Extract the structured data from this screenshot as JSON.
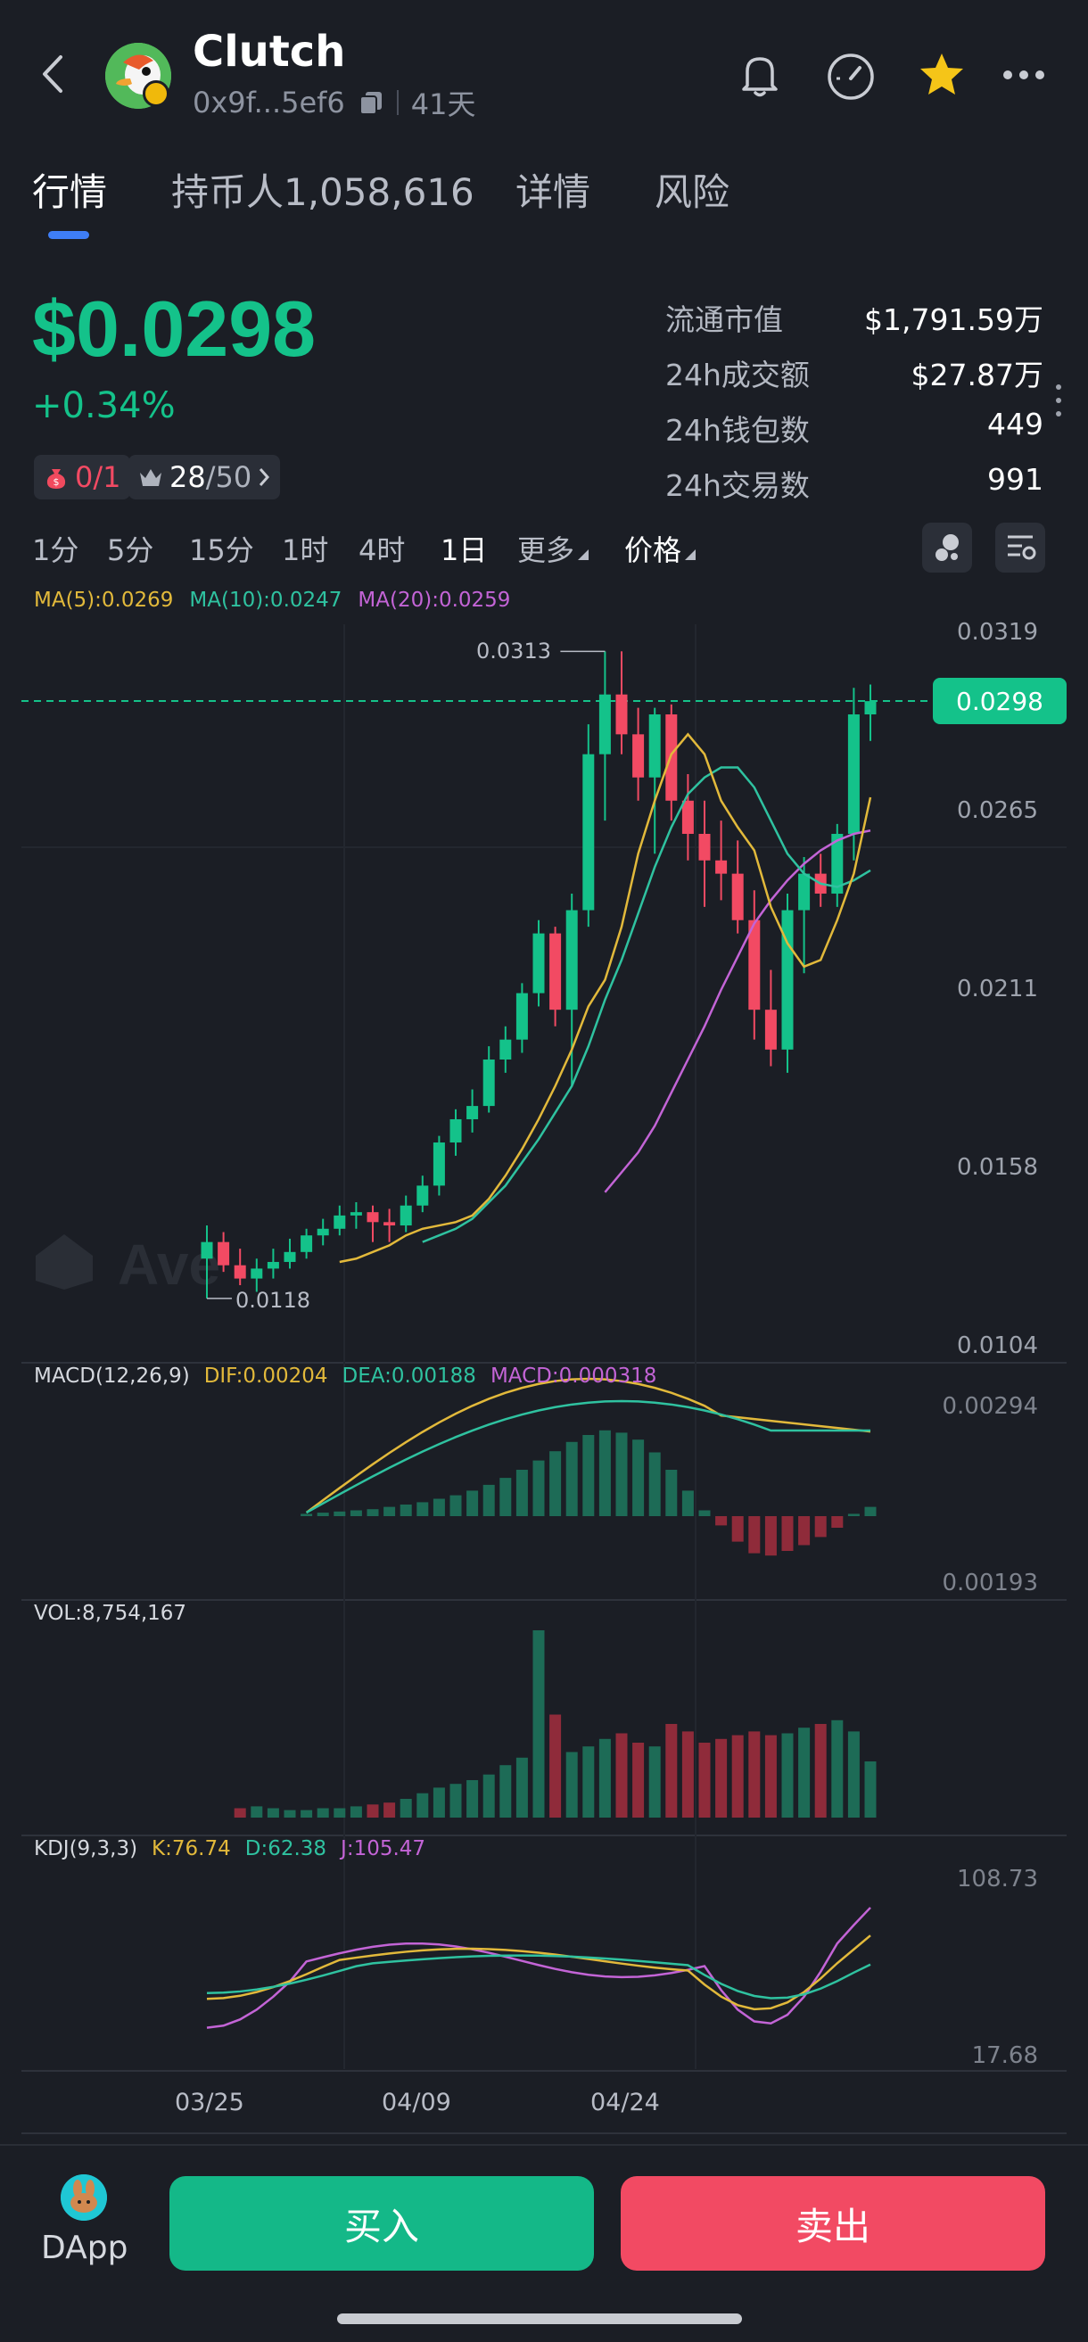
{
  "header": {
    "title": "Clutch",
    "address": "0x9f...5ef6",
    "age": "41天"
  },
  "tabs": [
    {
      "label": "行情"
    },
    {
      "label": "持币人1,058,616"
    },
    {
      "label": "详情"
    },
    {
      "label": "风险"
    }
  ],
  "price": {
    "value": "$0.0298",
    "change": "+0.34%",
    "badge1": "0/1",
    "badge2_value": "28",
    "badge2_total": "/50"
  },
  "stats": [
    {
      "label": "流通市值",
      "value": "$1,791.59万"
    },
    {
      "label": "24h成交额",
      "value": "$27.87万"
    },
    {
      "label": "24h钱包数",
      "value": "449"
    },
    {
      "label": "24h交易数",
      "value": "991"
    }
  ],
  "timeframes": [
    "1分",
    "5分",
    "15分",
    "1时",
    "4时",
    "1日",
    "更多",
    "价格"
  ],
  "chart": {
    "ma_legend": [
      "MA(5):0.0269",
      "MA(10):0.0247",
      "MA(20):0.0259"
    ],
    "price_axis": [
      "0.0319",
      "0.0265",
      "0.0211",
      "0.0158",
      "0.0104"
    ],
    "current_tag": "0.0298",
    "high_label": "0.0313",
    "low_label": "0.0118",
    "watermark": "Ave",
    "macd_legend": [
      "MACD(12,26,9)",
      "DIF:0.00204",
      "DEA:0.00188",
      "MACD:0.000318"
    ],
    "macd_axis": [
      "0.00294",
      "0.00193"
    ],
    "vol_legend": "VOL:8,754,167",
    "kdj_legend": [
      "KDJ(9,3,3)",
      "K:76.74",
      "D:62.38",
      "J:105.47"
    ],
    "kdj_axis": [
      "108.73",
      "17.68"
    ],
    "x_labels": [
      "03/25",
      "04/09",
      "04/24"
    ]
  },
  "colors": {
    "up": "#14c28a",
    "down": "#f24a63",
    "ma5": "#e2b93b",
    "ma10": "#2fc2a0",
    "ma20": "#c364d6"
  },
  "chart_data": {
    "type": "candlestick",
    "x_labels": [
      "03/25",
      "04/09",
      "04/24"
    ],
    "ylim": [
      0.0104,
      0.0319
    ],
    "candles_ohlc": [
      [
        0.013,
        0.014,
        0.0118,
        0.0135
      ],
      [
        0.0135,
        0.0138,
        0.0126,
        0.0128
      ],
      [
        0.0128,
        0.0133,
        0.0122,
        0.0124
      ],
      [
        0.0124,
        0.013,
        0.012,
        0.0127
      ],
      [
        0.0127,
        0.0133,
        0.0124,
        0.0129
      ],
      [
        0.0129,
        0.0136,
        0.0127,
        0.0132
      ],
      [
        0.0132,
        0.0139,
        0.013,
        0.0137
      ],
      [
        0.0137,
        0.0142,
        0.0134,
        0.0139
      ],
      [
        0.0139,
        0.0146,
        0.0137,
        0.0143
      ],
      [
        0.0143,
        0.0147,
        0.0139,
        0.0144
      ],
      [
        0.0144,
        0.0146,
        0.0135,
        0.0141
      ],
      [
        0.0141,
        0.0145,
        0.0135,
        0.014
      ],
      [
        0.014,
        0.0149,
        0.0138,
        0.0146
      ],
      [
        0.0146,
        0.0155,
        0.0144,
        0.0152
      ],
      [
        0.0152,
        0.0167,
        0.0149,
        0.0165
      ],
      [
        0.0165,
        0.0175,
        0.0161,
        0.0172
      ],
      [
        0.0172,
        0.0181,
        0.0168,
        0.0176
      ],
      [
        0.0176,
        0.0194,
        0.0174,
        0.019
      ],
      [
        0.019,
        0.02,
        0.0186,
        0.0196
      ],
      [
        0.0196,
        0.0213,
        0.0192,
        0.021
      ],
      [
        0.021,
        0.0232,
        0.0206,
        0.0228
      ],
      [
        0.0228,
        0.023,
        0.02,
        0.0205
      ],
      [
        0.0205,
        0.024,
        0.0182,
        0.0235
      ],
      [
        0.0235,
        0.0291,
        0.023,
        0.0282
      ],
      [
        0.0282,
        0.0313,
        0.0262,
        0.03
      ],
      [
        0.03,
        0.0313,
        0.0282,
        0.0288
      ],
      [
        0.0288,
        0.0296,
        0.0268,
        0.0275
      ],
      [
        0.0275,
        0.0296,
        0.0252,
        0.0294
      ],
      [
        0.0294,
        0.0297,
        0.0262,
        0.0268
      ],
      [
        0.0268,
        0.0276,
        0.025,
        0.0258
      ],
      [
        0.0258,
        0.0268,
        0.0236,
        0.025
      ],
      [
        0.025,
        0.0262,
        0.0238,
        0.0246
      ],
      [
        0.0246,
        0.0256,
        0.0228,
        0.0232
      ],
      [
        0.0232,
        0.0241,
        0.0196,
        0.0205
      ],
      [
        0.0205,
        0.0217,
        0.0188,
        0.0193
      ],
      [
        0.0193,
        0.024,
        0.0186,
        0.0235
      ],
      [
        0.0235,
        0.0251,
        0.0216,
        0.0246
      ],
      [
        0.0246,
        0.0252,
        0.0236,
        0.024
      ],
      [
        0.024,
        0.0261,
        0.0236,
        0.0258
      ],
      [
        0.0258,
        0.0302,
        0.025,
        0.0294
      ],
      [
        0.0294,
        0.0303,
        0.0286,
        0.0298
      ]
    ],
    "ma5": [
      0.0129,
      0.013,
      0.0132,
      0.0134,
      0.0137,
      0.0139,
      0.014,
      0.0141,
      0.0143,
      0.0148,
      0.0155,
      0.0163,
      0.0172,
      0.0182,
      0.0193,
      0.0206,
      0.0214,
      0.023,
      0.0252,
      0.0268,
      0.0282,
      0.0288,
      0.0282,
      0.0268,
      0.026,
      0.0253,
      0.0236,
      0.0225,
      0.0218,
      0.022,
      0.0232,
      0.0246,
      0.0269
    ],
    "ma10": [
      0.0135,
      0.0137,
      0.0139,
      0.0142,
      0.0147,
      0.0152,
      0.0159,
      0.0166,
      0.0174,
      0.0182,
      0.0194,
      0.0208,
      0.022,
      0.0234,
      0.0248,
      0.026,
      0.027,
      0.0275,
      0.0278,
      0.0278,
      0.0272,
      0.0262,
      0.0252,
      0.0246,
      0.0243,
      0.0242,
      0.0244,
      0.0247
    ],
    "ma20": [
      0.015,
      0.0156,
      0.0162,
      0.017,
      0.018,
      0.019,
      0.02,
      0.0211,
      0.0221,
      0.0231,
      0.0238,
      0.0244,
      0.0249,
      0.0253,
      0.0256,
      0.0258,
      0.0259
    ],
    "macd_hist": [
      2e-05,
      3e-05,
      4e-05,
      5e-05,
      6e-05,
      8e-05,
      0.0001,
      0.00012,
      0.00015,
      0.00018,
      0.00022,
      0.00027,
      0.00033,
      0.0004,
      0.00048,
      0.00056,
      0.00064,
      0.0007,
      0.00074,
      0.00072,
      0.00066,
      0.00055,
      0.0004,
      0.00022,
      5e-05,
      -8e-05,
      -0.00022,
      -0.00032,
      -0.00034,
      -0.0003,
      -0.00025,
      -0.00018,
      -0.0001,
      2e-05,
      8e-05
    ],
    "volume": [
      0.05,
      0.06,
      0.05,
      0.04,
      0.04,
      0.05,
      0.05,
      0.06,
      0.07,
      0.08,
      0.1,
      0.13,
      0.16,
      0.18,
      0.2,
      0.23,
      0.28,
      0.32,
      1.0,
      0.55,
      0.35,
      0.38,
      0.42,
      0.45,
      0.4,
      0.38,
      0.5,
      0.46,
      0.4,
      0.42,
      0.44,
      0.46,
      0.44,
      0.45,
      0.48,
      0.5,
      0.52,
      0.46,
      0.3
    ],
    "kdj": {
      "K_last": 76.74,
      "D_last": 62.38,
      "J_last": 105.47,
      "ylim": [
        17.68,
        108.73
      ]
    }
  }
}
